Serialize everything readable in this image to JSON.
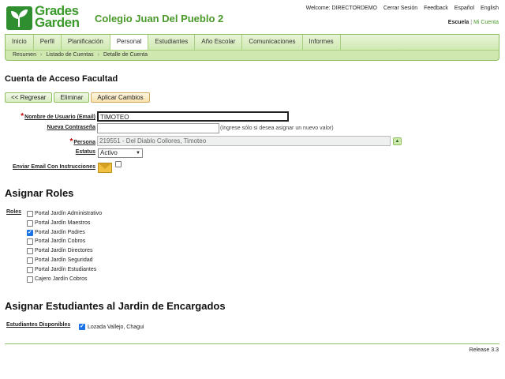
{
  "header": {
    "logo_text_line1": "Grades",
    "logo_text_line2": "Garden",
    "school_name": "Colegio Juan Del Pueblo 2",
    "welcome": "Welcome: DIRECTORDEMO",
    "logout": "Cerrar Sesión",
    "feedback": "Feedback",
    "lang_es": "Español",
    "lang_en": "English",
    "school_link": "Escuela",
    "my_account_link": "Mi Cuenta"
  },
  "nav": {
    "tabs": [
      {
        "label": "Inicio"
      },
      {
        "label": "Perfil"
      },
      {
        "label": "Planificación"
      },
      {
        "label": "Personal"
      },
      {
        "label": "Estudiantes"
      },
      {
        "label": "Año Escolar"
      },
      {
        "label": "Comunicaciones"
      },
      {
        "label": "Informes"
      }
    ],
    "active": "Personal"
  },
  "breadcrumb": [
    "Resumen",
    "Listado de Cuentas",
    "Detalle de Cuenta"
  ],
  "page_title": "Cuenta de Acceso Facultad",
  "buttons": {
    "back": "<< Regresar",
    "delete": "Eliminar",
    "apply": "Aplicar Cambios"
  },
  "form": {
    "username_label": "Nombre de Usuario (Email)",
    "username_value": "TIMOTEO",
    "password_label": "Nueva Contraseña",
    "password_value": "",
    "password_hint": "(Ingrese sólo si desea asignar un nuevo valor)",
    "person_label": "Persona",
    "person_value": "219551 - Del Diablo Collores, Timoteo",
    "status_label": "Estatus",
    "status_value": "Activo",
    "email_instructions_label": "Enviar Email Con Instrucciones",
    "email_instructions_checked": false
  },
  "roles_section": {
    "title": "Asignar Roles",
    "label": "Roles",
    "items": [
      {
        "label": "Portal Jardín Administrativo",
        "checked": false
      },
      {
        "label": "Portal Jardín Maestros",
        "checked": false
      },
      {
        "label": "Portal Jardín Padres",
        "checked": true
      },
      {
        "label": "Portal Jardín Cobros",
        "checked": false
      },
      {
        "label": "Portal Jardín Directores",
        "checked": false
      },
      {
        "label": "Portal Jardín Seguridad",
        "checked": false
      },
      {
        "label": "Portal Jardín Estudiantes",
        "checked": false
      },
      {
        "label": "Cajero Jardín Cobros",
        "checked": false
      }
    ]
  },
  "students_section": {
    "title": "Asignar Estudiantes al Jardin de Encargados",
    "label": "Estudiantes Disponibles",
    "students": [
      {
        "name": "Lozada Vallejo, Chagui",
        "checked": true
      }
    ]
  },
  "footer": {
    "release": "Release 3.3"
  }
}
